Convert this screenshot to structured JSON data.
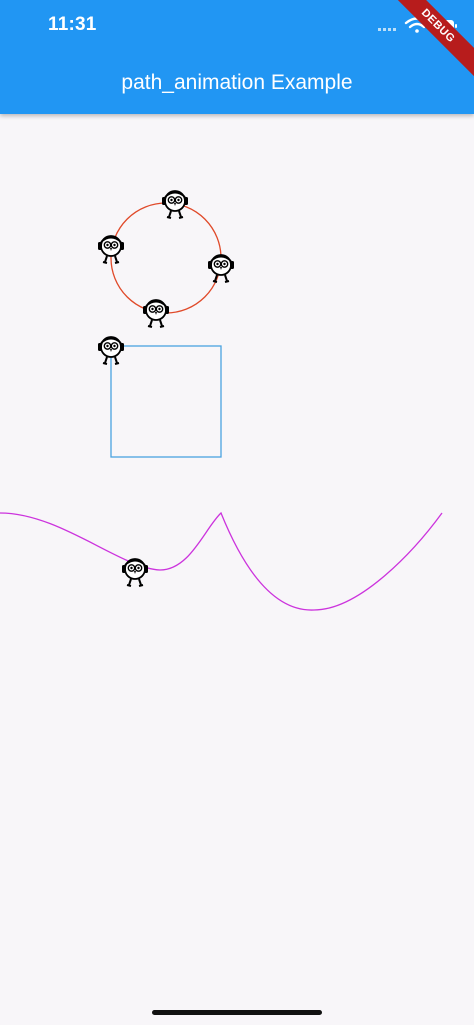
{
  "status_bar": {
    "time": "11:31"
  },
  "app_bar": {
    "title": "path_animation Example",
    "color": "#2196f3"
  },
  "debug_banner": {
    "label": "DEBUG",
    "color": "#b71c1c"
  },
  "paths": {
    "circle_color": "#e04a2a",
    "square_color": "#4aa3e0",
    "wave_color": "#cc33dd"
  },
  "icons": {
    "sprite": "owl-with-headphones-icon"
  }
}
